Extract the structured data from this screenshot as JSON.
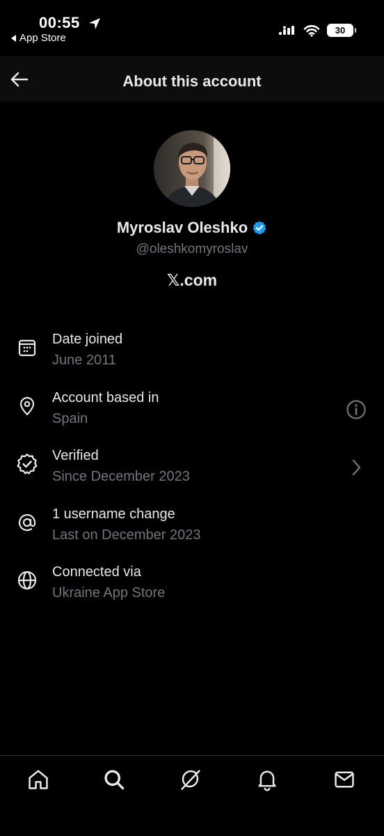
{
  "status_bar": {
    "time": "00:55",
    "back_app_label": "App Store",
    "battery_level": "30"
  },
  "header": {
    "title": "About this account"
  },
  "profile": {
    "name": "Myroslav Oleshko",
    "handle": "@oleshkomyroslav",
    "site": "𝕏.com",
    "verified_color": "#1d9bf0"
  },
  "info_items": [
    {
      "icon": "calendar-icon",
      "title": "Date joined",
      "subtitle": "June 2011",
      "action": null
    },
    {
      "icon": "location-pin-icon",
      "title": "Account based in",
      "subtitle": "Spain",
      "action": "info-icon"
    },
    {
      "icon": "verified-badge-icon",
      "title": "Verified",
      "subtitle": "Since December 2023",
      "action": "chevron-right-icon"
    },
    {
      "icon": "at-sign-icon",
      "title": "1 username change",
      "subtitle": "Last on December 2023",
      "action": null
    },
    {
      "icon": "globe-icon",
      "title": "Connected via",
      "subtitle": "Ukraine App Store",
      "action": null
    }
  ],
  "bottom_nav": [
    {
      "icon": "home-icon"
    },
    {
      "icon": "search-icon"
    },
    {
      "icon": "grok-icon"
    },
    {
      "icon": "bell-icon"
    },
    {
      "icon": "mail-icon"
    }
  ],
  "colors": {
    "background": "#000000",
    "header_background": "#0d0d0d",
    "text_primary": "#e7e9ea",
    "text_secondary": "#71767b",
    "accent": "#1d9bf0"
  }
}
